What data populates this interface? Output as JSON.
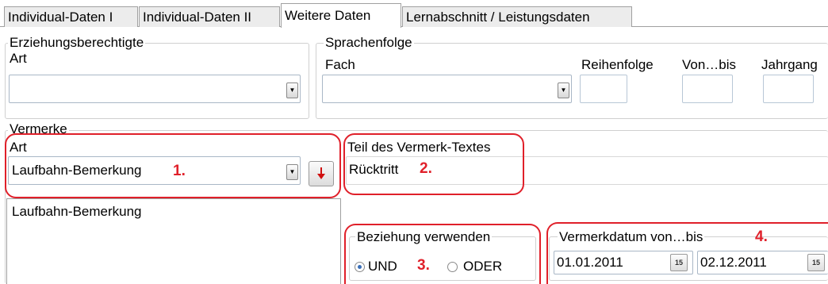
{
  "tabs": [
    {
      "label": "Individual-Daten I"
    },
    {
      "label": "Individual-Daten II"
    },
    {
      "label": "Weitere Daten"
    },
    {
      "label": "Lernabschnitt / Leistungsdaten"
    }
  ],
  "active_tab": "Weitere Daten",
  "erziehungsberechtigte": {
    "legend": "Erziehungsberechtigte",
    "art_label": "Art",
    "art_value": ""
  },
  "sprachenfolge": {
    "legend": "Sprachenfolge",
    "fach_label": "Fach",
    "fach_value": "",
    "reihenfolge_label": "Reihenfolge",
    "vonbis_label": "Von…bis",
    "jahrgang_label": "Jahrgang"
  },
  "vermerke": {
    "legend": "Vermerke",
    "art_label": "Art",
    "art_value": "Laufbahn-Bemerkung",
    "teil_label": "Teil des Vermerk-Textes",
    "teil_value": "Rücktritt",
    "list_items": [
      "Laufbahn-Bemerkung"
    ],
    "beziehung_legend": "Beziehung verwenden",
    "und_label": "UND",
    "oder_label": "ODER",
    "selected_relation": "UND",
    "datum_label": "Vermerkdatum von…bis",
    "datum_von": "01.01.2011",
    "datum_bis": "02.12.2011"
  },
  "annotations": [
    "1.",
    "2.",
    "3.",
    "4."
  ],
  "colors": {
    "annotation": "#e0202a",
    "accent_radio": "#3a6fb8",
    "add_arrow": "#d01010"
  },
  "icons": [
    "dropdown-arrow-icon",
    "red-down-arrow-icon",
    "calendar-icon"
  ]
}
